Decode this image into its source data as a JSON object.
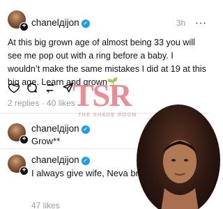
{
  "post": {
    "username": "chanelдijon",
    "time": "3h",
    "text": "At this big grown age of almost being 33 you will see me pop out with a ring before a baby. I wouldn’t  make the same mistakes I did at 19 at this big age. Learn and grown",
    "sprout": "🌱",
    "meta": "2 replies · 40 likes"
  },
  "replies": [
    {
      "username": "chanelдijon",
      "text": "Grow**"
    },
    {
      "username": "chanelдijon",
      "text": "I always give wife, Neva bm",
      "meta": "47 likes"
    }
  ],
  "watermark": {
    "logo": "TSR",
    "sub": "THE SHADE ROOM"
  },
  "colors": {
    "verified": "#1d9bf0",
    "watermark": "#eb7882",
    "muted": "#9a9a9a"
  },
  "icons": [
    "heart-icon",
    "comment-icon",
    "repost-icon",
    "share-icon",
    "more-icon",
    "verified-icon"
  ]
}
